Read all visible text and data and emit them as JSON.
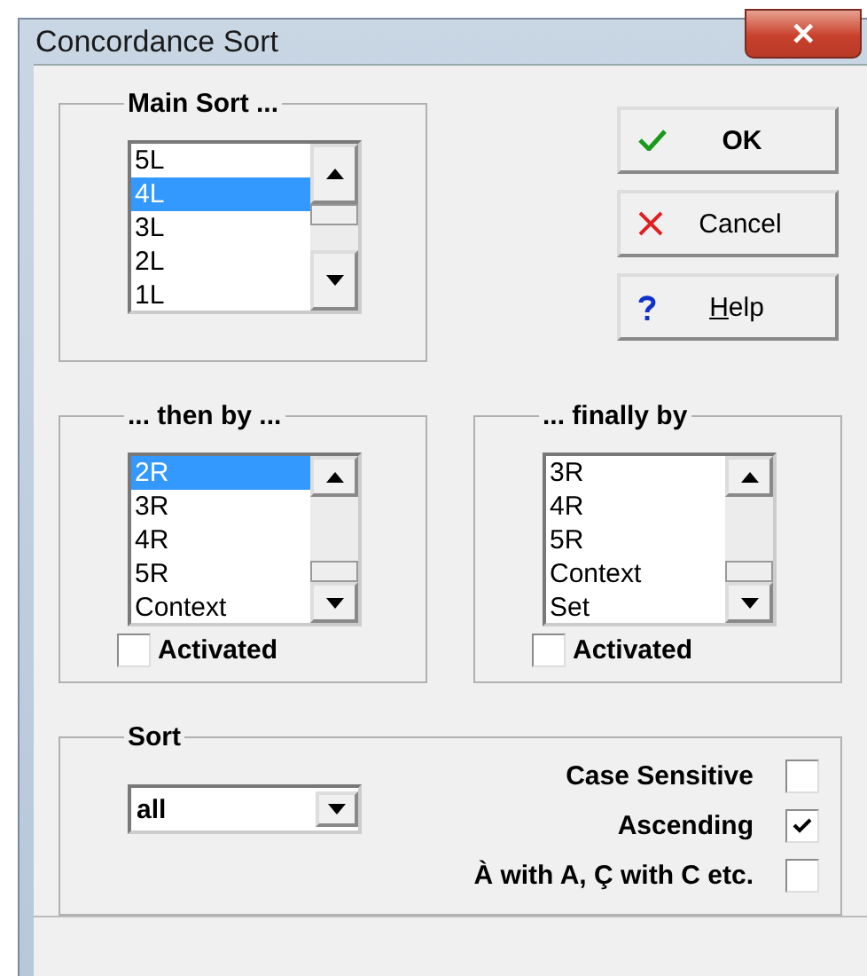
{
  "window": {
    "title": "Concordance Sort",
    "close": "✕"
  },
  "main_sort": {
    "label": "Main Sort ...",
    "items": [
      {
        "text": "5L",
        "selected": false
      },
      {
        "text": "4L",
        "selected": true
      },
      {
        "text": "3L",
        "selected": false
      },
      {
        "text": "2L",
        "selected": false
      },
      {
        "text": "1L",
        "selected": false
      }
    ]
  },
  "buttons": [
    {
      "kind": "ok",
      "label": "OK"
    },
    {
      "kind": "cancel",
      "label": "Cancel"
    },
    {
      "kind": "help",
      "label": "Help"
    }
  ],
  "then_by": {
    "label": "... then by ...",
    "items": [
      {
        "text": "2R",
        "selected": true
      },
      {
        "text": "3R",
        "selected": false
      },
      {
        "text": "4R",
        "selected": false
      },
      {
        "text": "5R",
        "selected": false
      },
      {
        "text": "Context",
        "selected": false
      }
    ],
    "activated": {
      "label": "Activated",
      "checked": false
    }
  },
  "finally_by": {
    "label": "... finally by",
    "items": [
      {
        "text": "3R",
        "selected": false
      },
      {
        "text": "4R",
        "selected": false
      },
      {
        "text": "5R",
        "selected": false
      },
      {
        "text": "Context",
        "selected": false
      },
      {
        "text": "Set",
        "selected": false
      }
    ],
    "activated": {
      "label": "Activated",
      "checked": false
    }
  },
  "sort": {
    "label": "Sort",
    "dropdown": "all",
    "options": [
      {
        "label": "Case Sensitive",
        "checked": false
      },
      {
        "label": "Ascending",
        "checked": true
      },
      {
        "label": "À with A, Ç with C etc.",
        "checked": false
      }
    ]
  }
}
